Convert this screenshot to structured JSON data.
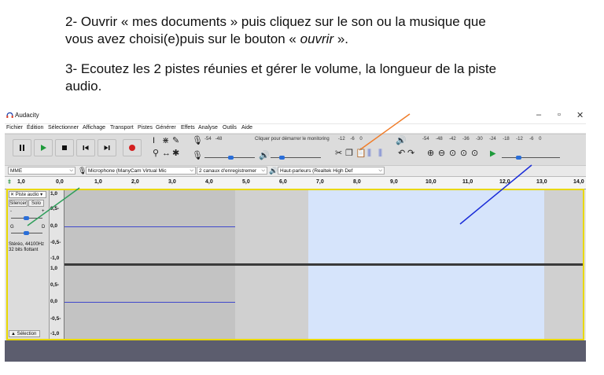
{
  "instructions": {
    "step2_line1": "2- Ouvrir « mes documents » puis cliquez sur le son ou la musique que",
    "step2_line2_prefix": "vous avez choisi(e)puis sur le bouton « ",
    "step2_line2_italic": "ouvrir",
    "step2_line2_suffix": " ».",
    "step3_line1": "3- Ecoutez les 2 pistes réunies et gérer le volume, la longueur de la piste",
    "step3_line2": "audio."
  },
  "window": {
    "title": "Audacity",
    "minimize": "–",
    "maximize": "▫",
    "close": "✕"
  },
  "menu": [
    "Fichier",
    "Édition",
    "Sélectionner",
    "Affichage",
    "Transport",
    "Pistes",
    "Générer",
    "Effets",
    "Analyse",
    "Outils",
    "Aide"
  ],
  "meters": {
    "record_scale": [
      "-54",
      "-48"
    ],
    "record_hint": "Cliquer pour démarrer le monitoring",
    "record_scale2": [
      "-12",
      "-6",
      "0"
    ],
    "play_scale": [
      "-54",
      "-48",
      "-42",
      "-36",
      "-30",
      "-24",
      "-18",
      "-12",
      "-6",
      "0"
    ]
  },
  "devices": {
    "host": "MME",
    "mic": "Microphone (ManyCam Virtual Mic",
    "channels": "2 canaux d'enregistremer",
    "speakers": "Haut-parleurs (Realtek High Def"
  },
  "ruler": {
    "start": "1,0",
    "ticks": [
      "0,0",
      "1,0",
      "2,0",
      "3,0",
      "4,0",
      "5,0",
      "6,0",
      "7,0",
      "8,0",
      "9,0",
      "10,0",
      "11,0",
      "12,0",
      "13,0",
      "14,0"
    ]
  },
  "track": {
    "name": "Piste audio",
    "close": "✕",
    "silence_label": "Silencer",
    "solo_label": "Solo",
    "gain_minus": "-",
    "gain_plus": "+",
    "pan_left": "G",
    "pan_right": "D",
    "info_line1": "Stéréo, 44100Hz",
    "info_line2": "32 bits flottant",
    "select_label": "Sélection",
    "scale_ch1": [
      "1,0",
      "0,5-",
      "0,0",
      "-0,5-",
      "-1,0"
    ],
    "scale_ch2": [
      "1,0",
      "0,5-",
      "0,0",
      "-0,5-",
      "-1,0"
    ]
  },
  "colors": {
    "selection": "#d6e4fb",
    "waveform": "#3f48cc",
    "track_focus": "#e9d800",
    "annotation_orange": "#f07d2a",
    "annotation_green": "#2e9e5a",
    "annotation_blue": "#1a2cd8"
  }
}
